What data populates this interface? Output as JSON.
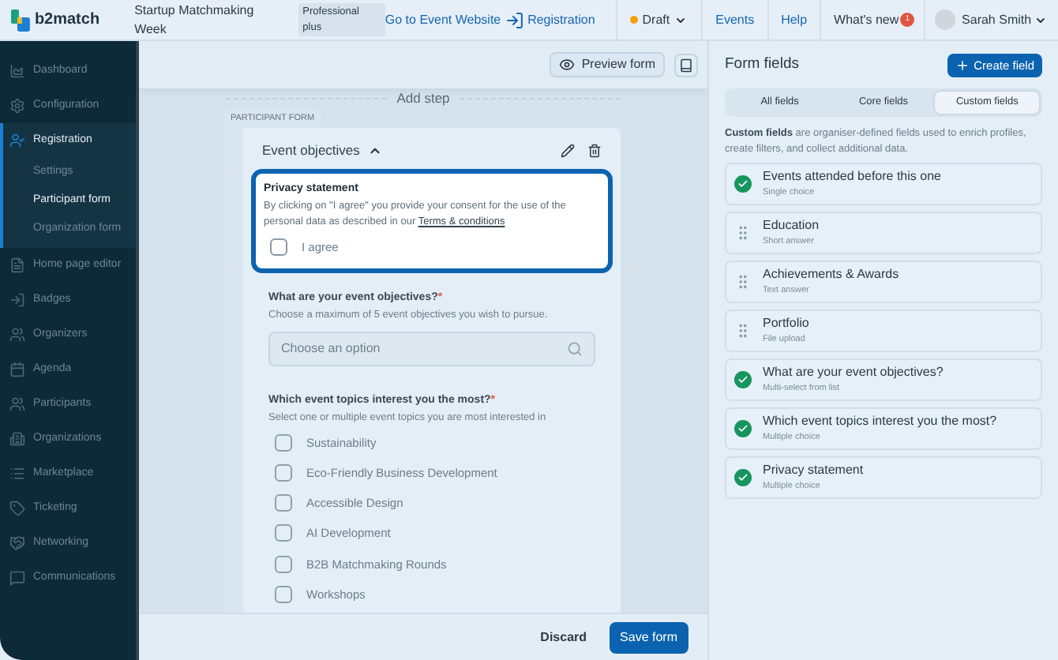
{
  "topbar": {
    "logo": "b2match",
    "event_name": "Startup Matchmaking Week",
    "plan_badge": "Professional plus",
    "website_link": "Go to Event Website",
    "registration_link": "Registration",
    "status": {
      "label": "Draft",
      "color": "#f59e0b"
    },
    "nav": [
      "Events",
      "Help"
    ],
    "whats_new": {
      "label": "What's new",
      "count": "1"
    },
    "user": {
      "name": "Sarah Smith"
    }
  },
  "sidebar": {
    "items": [
      {
        "label": "Dashboard",
        "selected": false,
        "expanded": false
      },
      {
        "label": "Configuration",
        "selected": false,
        "expanded": false
      },
      {
        "label": "Registration",
        "selected": true,
        "expanded": true,
        "children": [
          {
            "label": "Settings",
            "selected": false
          },
          {
            "label": "Participant form",
            "selected": true
          },
          {
            "label": "Organization form",
            "selected": false
          }
        ]
      },
      {
        "label": "Home page editor",
        "selected": false,
        "expanded": false
      },
      {
        "label": "Badges",
        "selected": false,
        "expanded": false
      },
      {
        "label": "Organizers",
        "selected": false,
        "expanded": false
      },
      {
        "label": "Agenda",
        "selected": false,
        "expanded": false
      },
      {
        "label": "Participants",
        "selected": false,
        "expanded": false
      },
      {
        "label": "Organizations",
        "selected": false,
        "expanded": false
      },
      {
        "label": "Marketplace",
        "selected": false,
        "expanded": false
      },
      {
        "label": "Ticketing",
        "selected": false,
        "expanded": false
      },
      {
        "label": "Networking",
        "selected": false,
        "expanded": false
      },
      {
        "label": "Communications",
        "selected": false,
        "expanded": false
      }
    ]
  },
  "toolbar": {
    "preview_button": "Preview form"
  },
  "form": {
    "add_step": "Add step",
    "tag": "PARTICIPANT FORM",
    "section": {
      "title": "Event objectives",
      "expanded": true
    },
    "questions": [
      {
        "kind": "consent",
        "highlighted": true,
        "title": "Privacy statement",
        "description": "By clicking on \"I agree\" you provide your consent for the use of the personal data as described in our",
        "link": "Terms & conditions",
        "options": [
          {
            "label": "I agree",
            "checked": false
          }
        ]
      },
      {
        "kind": "select",
        "highlighted": false,
        "title": "What are your event objectives?",
        "required_mark": "*",
        "description": "Choose a maximum of 5 event objectives you wish to pursue.",
        "placeholder": "Choose an option"
      },
      {
        "kind": "checkboxes",
        "highlighted": false,
        "title": "Which event topics interest you the most?",
        "required_mark": "*",
        "description": "Select one or multiple event topics you are most interested in",
        "options": [
          {
            "label": "Sustainability",
            "checked": false
          },
          {
            "label": "Eco-Friendly Business Development",
            "checked": false
          },
          {
            "label": "Accessible Design",
            "checked": false
          },
          {
            "label": "AI Development",
            "checked": false
          },
          {
            "label": "B2B Matchmaking Rounds",
            "checked": false
          },
          {
            "label": "Workshops",
            "checked": false
          }
        ]
      }
    ]
  },
  "footer": {
    "discard": "Discard",
    "save": "Save form"
  },
  "panel": {
    "title": "Form fields",
    "create_button": "Create field",
    "tabs": [
      {
        "label": "All fields",
        "selected": false
      },
      {
        "label": "Core fields",
        "selected": false
      },
      {
        "label": "Custom fields",
        "selected": true
      }
    ],
    "description": "**Custom fields** are organiser-defined fields used to enrich profiles, create filters, and collect additional data.",
    "fields": [
      {
        "name": "Events attended before this one",
        "type": "Single choice",
        "added": true
      },
      {
        "name": "Education",
        "type": "Short answer",
        "added": false
      },
      {
        "name": "Achievements & Awards",
        "type": "Text answer",
        "added": false
      },
      {
        "name": "Portfolio",
        "type": "File upload",
        "added": false
      },
      {
        "name": "What are your event objectives?",
        "type": "Multi-select from list",
        "added": true
      },
      {
        "name": "Which event topics interest you the most?",
        "type": "Multiple choice",
        "added": true
      },
      {
        "name": "Privacy statement",
        "type": "Multiple choice",
        "added": true
      }
    ]
  }
}
